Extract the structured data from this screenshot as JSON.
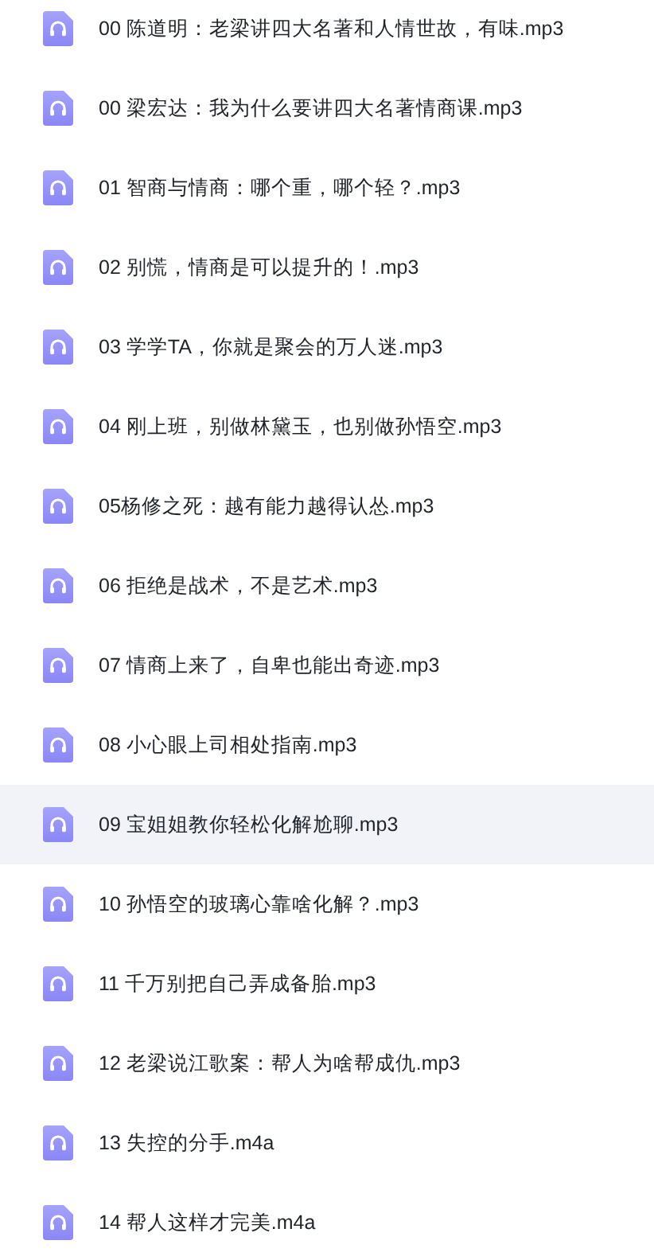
{
  "files": [
    {
      "name": "00 陈道明：老梁讲四大名著和人情世故，有味.mp3",
      "selected": false
    },
    {
      "name": "00 梁宏达：我为什么要讲四大名著情商课.mp3",
      "selected": false
    },
    {
      "name": "01 智商与情商：哪个重，哪个轻？.mp3",
      "selected": false
    },
    {
      "name": "02 别慌，情商是可以提升的！.mp3",
      "selected": false
    },
    {
      "name": "03 学学TA，你就是聚会的万人迷.mp3",
      "selected": false
    },
    {
      "name": "04 刚上班，别做林黛玉，也别做孙悟空.mp3",
      "selected": false
    },
    {
      "name": "05杨修之死：越有能力越得认怂.mp3",
      "selected": false
    },
    {
      "name": "06 拒绝是战术，不是艺术.mp3",
      "selected": false
    },
    {
      "name": "07 情商上来了，自卑也能出奇迹.mp3",
      "selected": false
    },
    {
      "name": "08 小心眼上司相处指南.mp3",
      "selected": false
    },
    {
      "name": "09 宝姐姐教你轻松化解尬聊.mp3",
      "selected": true
    },
    {
      "name": "10 孙悟空的玻璃心靠啥化解？.mp3",
      "selected": false
    },
    {
      "name": "11 千万别把自己弄成备胎.mp3",
      "selected": false
    },
    {
      "name": "12 老梁说江歌案：帮人为啥帮成仇.mp3",
      "selected": false
    },
    {
      "name": "13 失控的分手.m4a",
      "selected": false
    },
    {
      "name": "14 帮人这样才完美.m4a",
      "selected": false
    }
  ]
}
